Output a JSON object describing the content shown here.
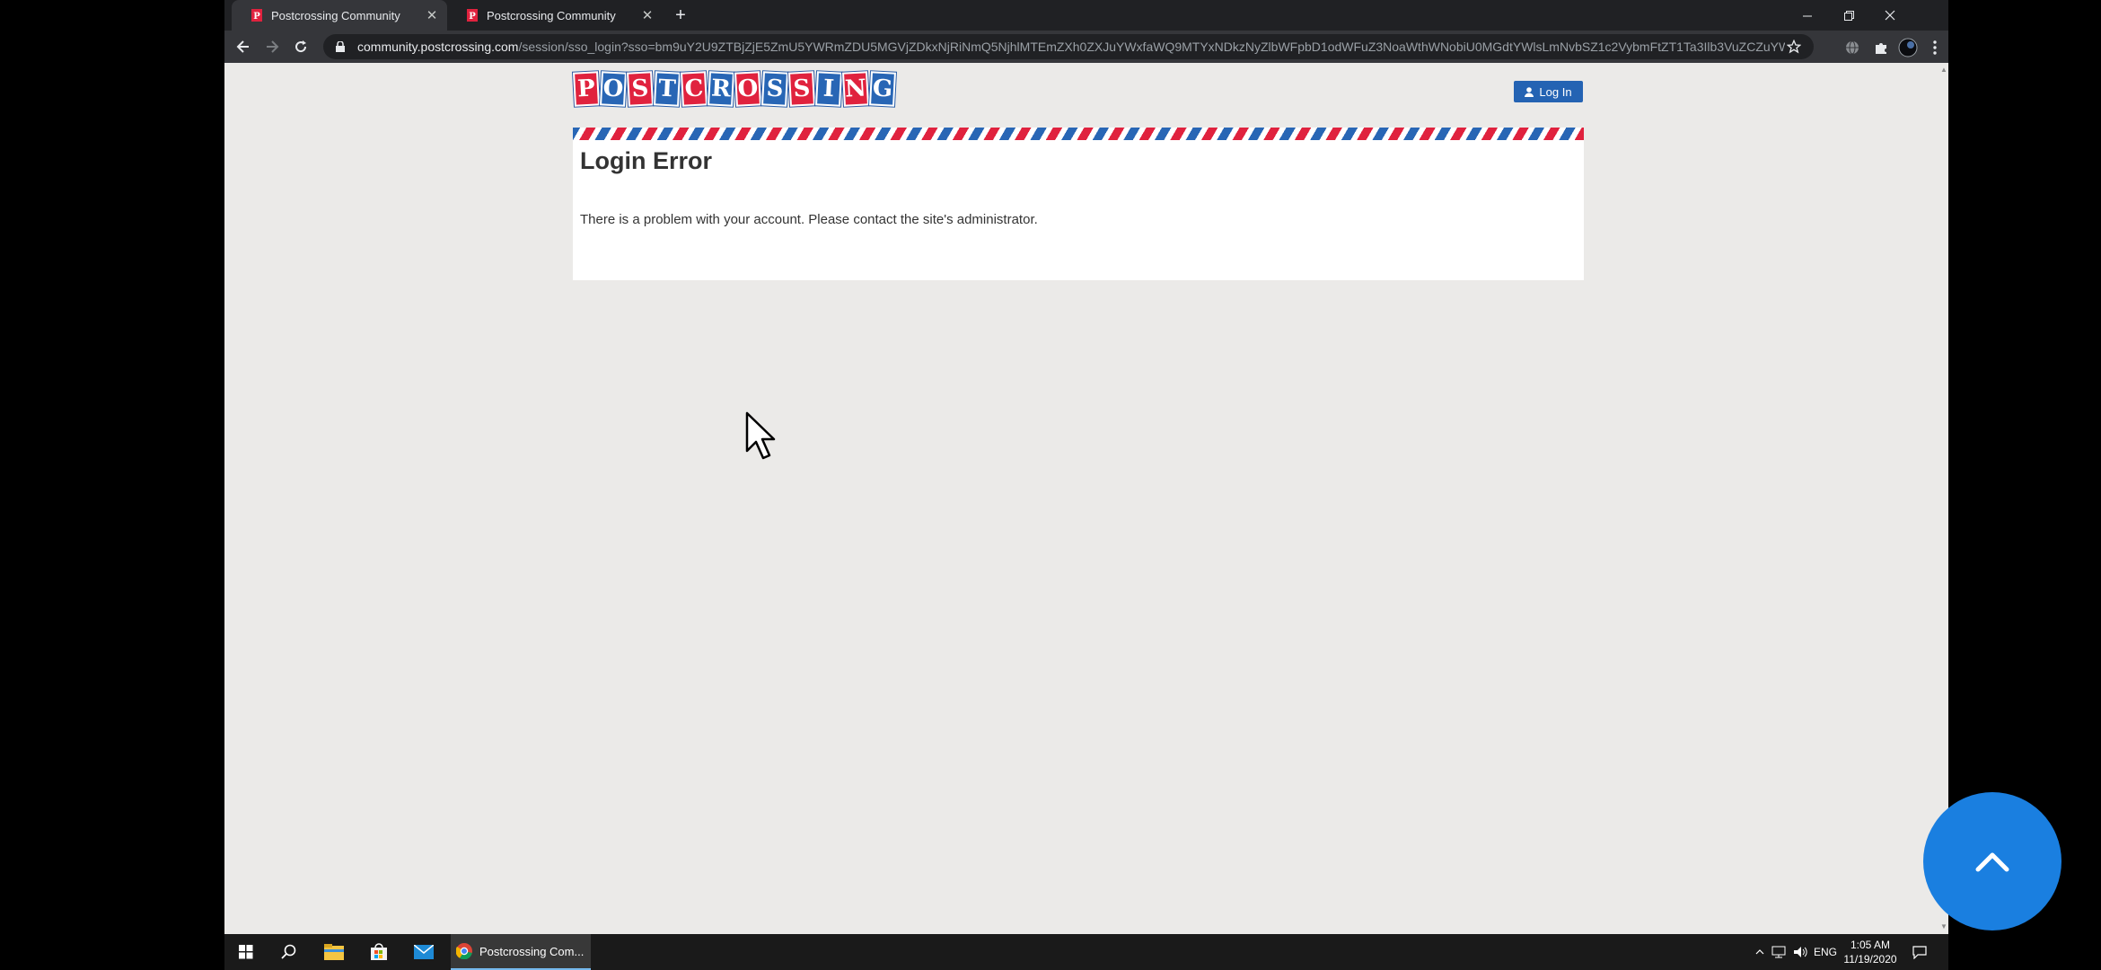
{
  "browser": {
    "tabs": [
      {
        "title": "Postcrossing Community",
        "active": true
      },
      {
        "title": "Postcrossing Community",
        "active": false
      }
    ],
    "url_host": "community.postcrossing.com",
    "url_rest": "/session/sso_login?sso=bm9uY2U9ZTBjZjE5ZmU5YWRmZDU5MGVjZDkxNjRiNmQ5NjhlMTEmZXh0ZXJuYWxfaWQ9MTYxNDkzNyZlbWFpbD1odWFuZ3NoaWthWNobiU0MGdtYWlsLmNvbSZ1c2VybmFtZT1Ta3Ilb3VuZCZuYW1lPV..."
  },
  "page": {
    "logo_letters": [
      "P",
      "O",
      "S",
      "T",
      "C",
      "R",
      "O",
      "S",
      "S",
      "I",
      "N",
      "G"
    ],
    "login_label": "Log In",
    "heading": "Login Error",
    "message": "There is a problem with your account. Please contact the site's administrator."
  },
  "taskbar": {
    "chrome_label": "Postcrossing Com...",
    "language": "ENG",
    "time": "1:05 AM",
    "date": "11/19/2020"
  },
  "colors": {
    "logo_red": "#e0223e",
    "logo_blue": "#2866b5",
    "login_button": "#2463b3",
    "fab": "#1a7fe0"
  }
}
